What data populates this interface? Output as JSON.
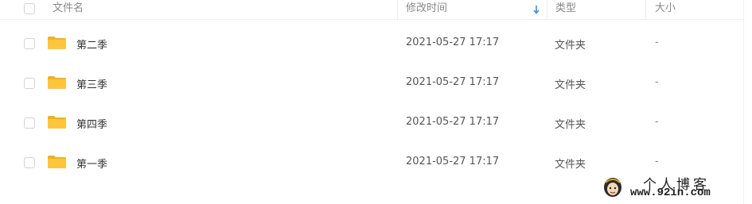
{
  "header": {
    "name_label": "文件名",
    "mtime_label": "修改时间",
    "type_label": "类型",
    "size_label": "大小",
    "sort_icon": "arrow-down-icon"
  },
  "rows": [
    {
      "name": "第二季",
      "mtime": "2021-05-27 17:17",
      "type": "文件夹",
      "size": "-"
    },
    {
      "name": "第三季",
      "mtime": "2021-05-27 17:17",
      "type": "文件夹",
      "size": "-"
    },
    {
      "name": "第四季",
      "mtime": "2021-05-27 17:17",
      "type": "文件夹",
      "size": "-"
    },
    {
      "name": "第一季",
      "mtime": "2021-05-27 17:17",
      "type": "文件夹",
      "size": "-"
    }
  ],
  "watermark": {
    "title": "个人博客",
    "url": "www.92in.com"
  },
  "colors": {
    "folder": "#ffc63d",
    "folder_tab": "#f2b218",
    "sort_arrow": "#3a8ee6"
  }
}
